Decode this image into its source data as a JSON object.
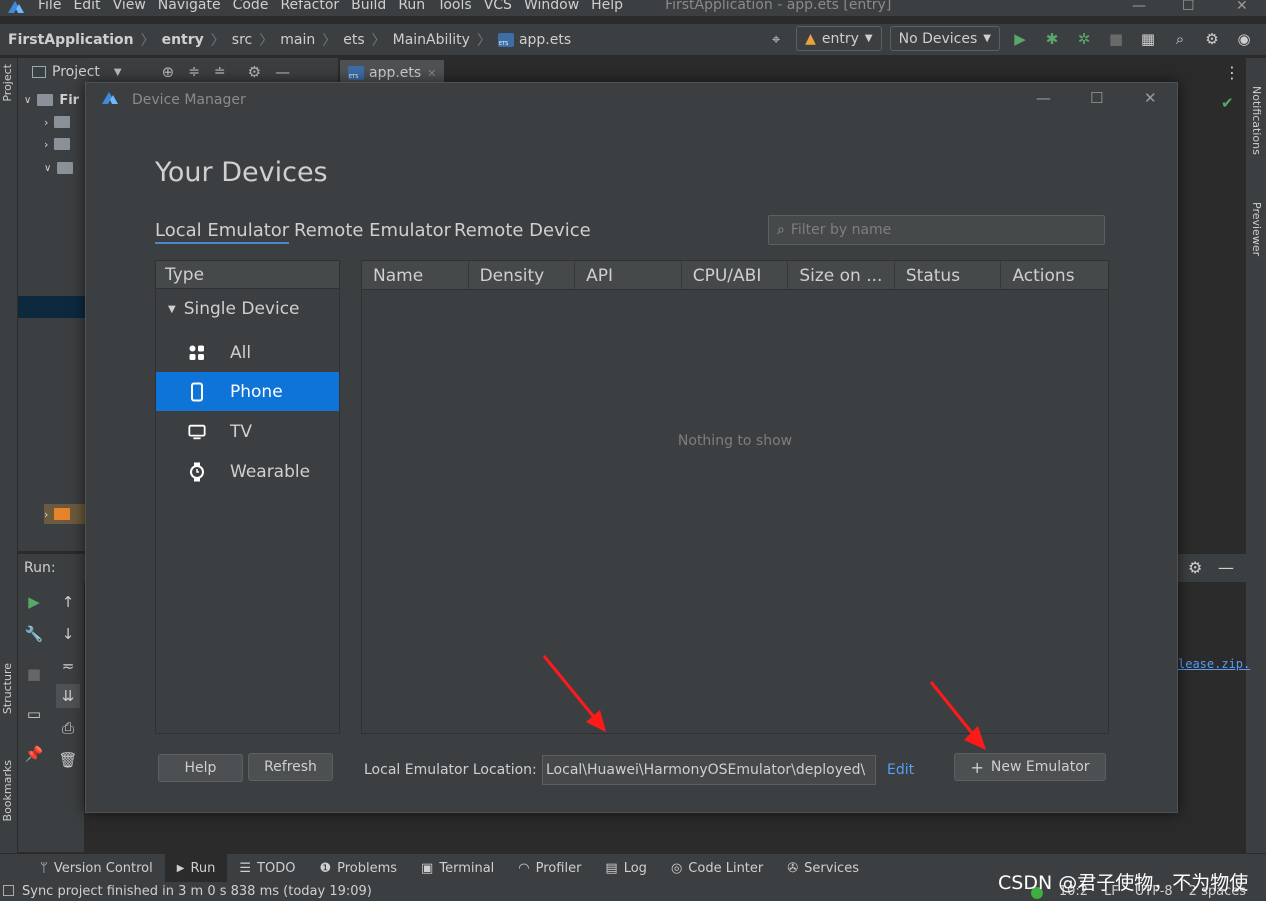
{
  "menubar": {
    "items": [
      "File",
      "Edit",
      "View",
      "Navigate",
      "Code",
      "Refactor",
      "Build",
      "Run",
      "Tools",
      "VCS",
      "Window",
      "Help"
    ],
    "window_title": "FirstApplication - app.ets [entry]"
  },
  "navbar": {
    "breadcrumbs": [
      "FirstApplication",
      "entry",
      "src",
      "main",
      "ets",
      "MainAbility",
      "app.ets"
    ],
    "module_combo": "entry",
    "device_combo": "No Devices"
  },
  "project_bar": {
    "label": "Project"
  },
  "editor_tab": {
    "label": "app.ets"
  },
  "tree": {
    "root_label": "Fir"
  },
  "side_stripes": {
    "left": [
      "Project",
      "Structure",
      "Bookmarks"
    ],
    "right": [
      "Notifications",
      "Previewer"
    ]
  },
  "run_panel": {
    "label": "Run:",
    "link_text": "lease.zip."
  },
  "dialog": {
    "title": "Device Manager",
    "heading": "Your Devices",
    "tabs": [
      "Local Emulator",
      "Remote Emulator",
      "Remote Device"
    ],
    "active_tab": "Local Emulator",
    "filter_placeholder": "Filter by name",
    "type_panel": {
      "header": "Type",
      "group": "Single Device",
      "items": [
        {
          "label": "All",
          "icon": "grid-icon"
        },
        {
          "label": "Phone",
          "icon": "phone-icon"
        },
        {
          "label": "TV",
          "icon": "tv-icon"
        },
        {
          "label": "Wearable",
          "icon": "watch-icon"
        }
      ],
      "selected": "Phone"
    },
    "table": {
      "columns": [
        "Name",
        "Density",
        "API",
        "CPU/ABI",
        "Size on ...",
        "Status",
        "Actions"
      ],
      "empty_text": "Nothing to show"
    },
    "buttons": {
      "help": "Help",
      "refresh": "Refresh",
      "new_emulator": "New Emulator"
    },
    "location": {
      "label": "Local Emulator Location:",
      "value": "\\Local\\Huawei\\HarmonyOSEmulator\\deployed",
      "edit": "Edit"
    }
  },
  "bottom_tabs": [
    "Version Control",
    "Run",
    "TODO",
    "Problems",
    "Terminal",
    "Profiler",
    "Log",
    "Code Linter",
    "Services"
  ],
  "status": {
    "message": "Sync project finished in 3 m 0 s 838 ms (today 19:09)",
    "position": "10:2",
    "line_ending": "LF",
    "encoding": "UTF-8",
    "indent": "2 spaces"
  },
  "watermark": "CSDN @君子使物，不为物使",
  "colors": {
    "accent": "#0e74d8",
    "link": "#589df6",
    "annotation_arrow": "#ff1a1a",
    "run_green": "#59a869"
  }
}
